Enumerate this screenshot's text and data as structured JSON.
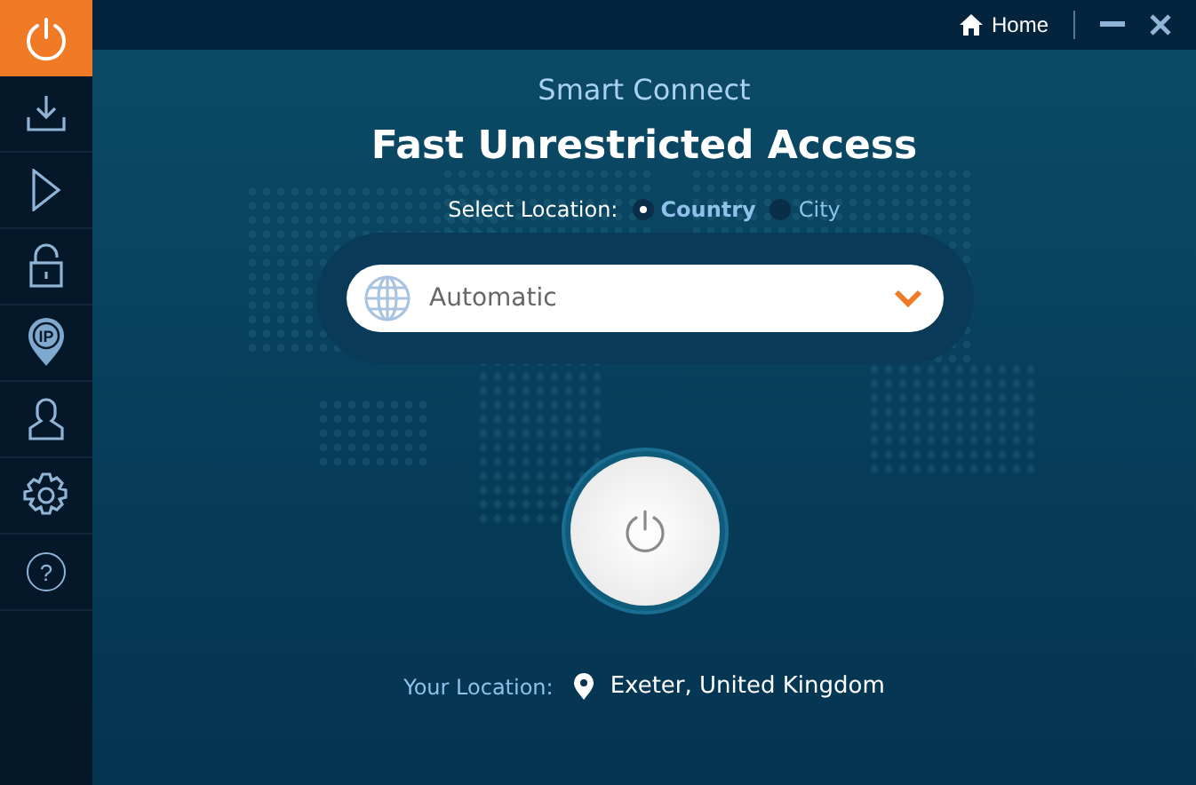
{
  "sidebar": {
    "items": [
      {
        "kind": "power",
        "selected": true
      },
      {
        "kind": "download",
        "selected": false
      },
      {
        "kind": "play",
        "selected": false
      },
      {
        "kind": "lock",
        "selected": false
      },
      {
        "kind": "ip",
        "selected": false,
        "label": "IP"
      },
      {
        "kind": "user",
        "selected": false
      },
      {
        "kind": "settings",
        "selected": false
      },
      {
        "kind": "help",
        "selected": false,
        "label": "?"
      }
    ]
  },
  "top_bar": {
    "home": "Home"
  },
  "subtitle": "Smart Connect",
  "title": "Fast Unrestricted Access",
  "location_select": {
    "label": "Select Location:",
    "options": [
      {
        "label": "Country",
        "selected": true
      },
      {
        "label": "City",
        "selected": false
      }
    ]
  },
  "dropdown": {
    "value": "Automatic"
  },
  "connected": false,
  "your_location": {
    "label": "Your Location:",
    "value": "Exeter, United Kingdom"
  }
}
